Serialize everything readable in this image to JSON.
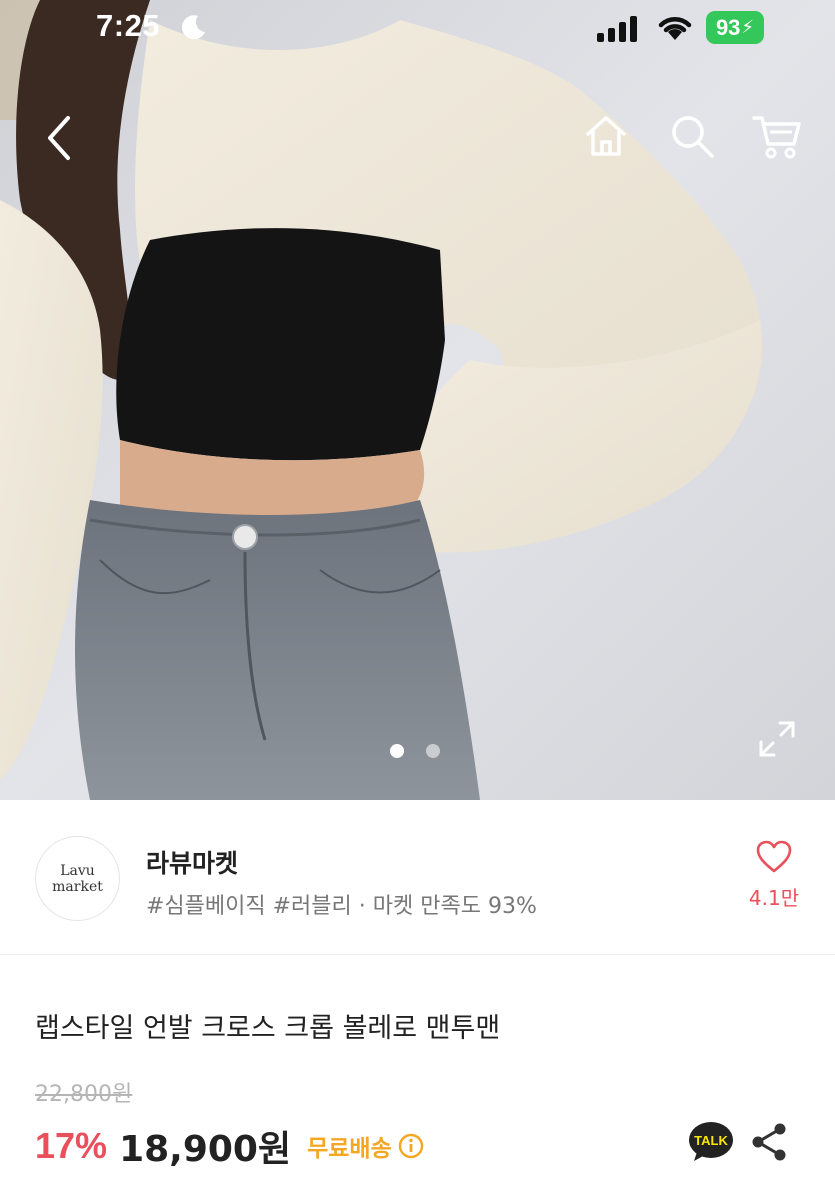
{
  "status_bar": {
    "time": "7:25",
    "battery": "93",
    "battery_color": "#34c759"
  },
  "navigation": {
    "icons": [
      "back-icon",
      "home-icon",
      "search-icon",
      "cart-icon"
    ]
  },
  "gallery": {
    "total_images": 2,
    "current_index": 1
  },
  "shop": {
    "logo_line1": "Lavu",
    "logo_line2": "market",
    "name": "라뷰마켓",
    "tags": "#심플베이직 #러블리 · 마켓 만족도 93%",
    "likes": "4.1만",
    "accent_color": "#e8505b"
  },
  "product": {
    "title": "랩스타일 언발 크로스 크롭 볼레로 맨투맨",
    "original_price": "22,800원",
    "discount": "17%",
    "price": "18,900원",
    "shipping": "무료배송",
    "talk_label": "TALK",
    "shipping_color": "#f5a623"
  }
}
